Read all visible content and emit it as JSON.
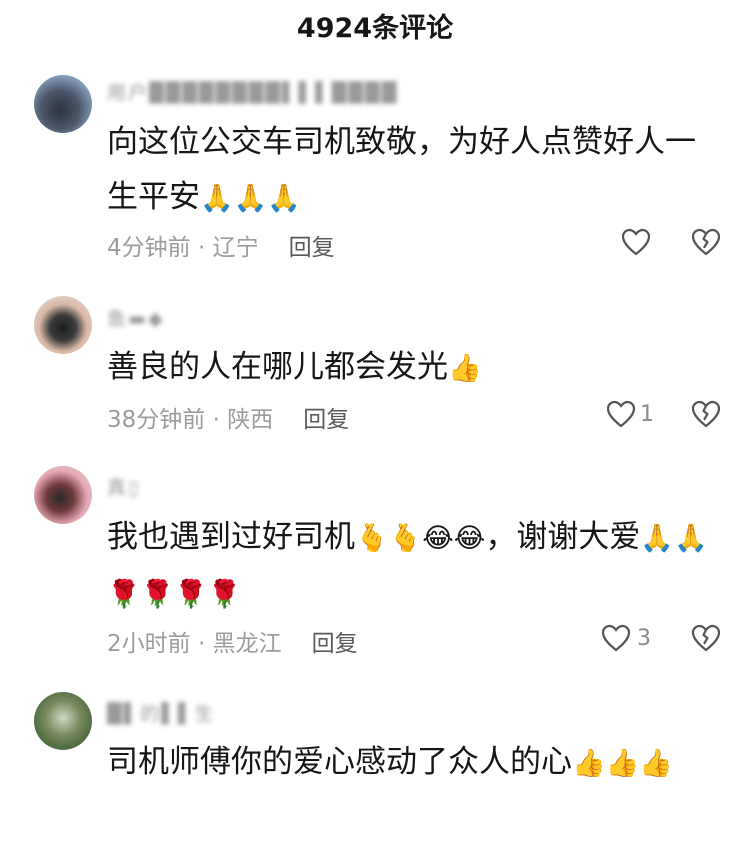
{
  "header": {
    "title": "4924条评论"
  },
  "comments": [
    {
      "username": "用户████████▌▌▌████",
      "text": "向这位公交车司机致敬，为好人点赞好人一生平安",
      "emojis": "🙏🙏🙏",
      "time_location": "4分钟前 · 辽宁",
      "reply_label": "回复",
      "like_count": ""
    },
    {
      "username": "鱼▬◆",
      "text": "善良的人在哪儿都会发光",
      "emojis": "👍",
      "time_location": "38分钟前 · 陕西",
      "reply_label": "回复",
      "like_count": "1"
    },
    {
      "username": "真▯",
      "text": "我也遇到过好司机",
      "emojis": "🫰🫰😂😂",
      "text2": "，谢谢大爱",
      "emojis2": "🙏🙏🌹🌹🌹🌹",
      "time_location": "2小时前 · 黑龙江",
      "reply_label": "回复",
      "like_count": "3"
    },
    {
      "username": "█▌的▌▌生",
      "text": "司机师傅你的爱心感动了众人的心",
      "emojis": "👍👍👍",
      "time_location": "",
      "reply_label": "",
      "like_count": ""
    }
  ]
}
